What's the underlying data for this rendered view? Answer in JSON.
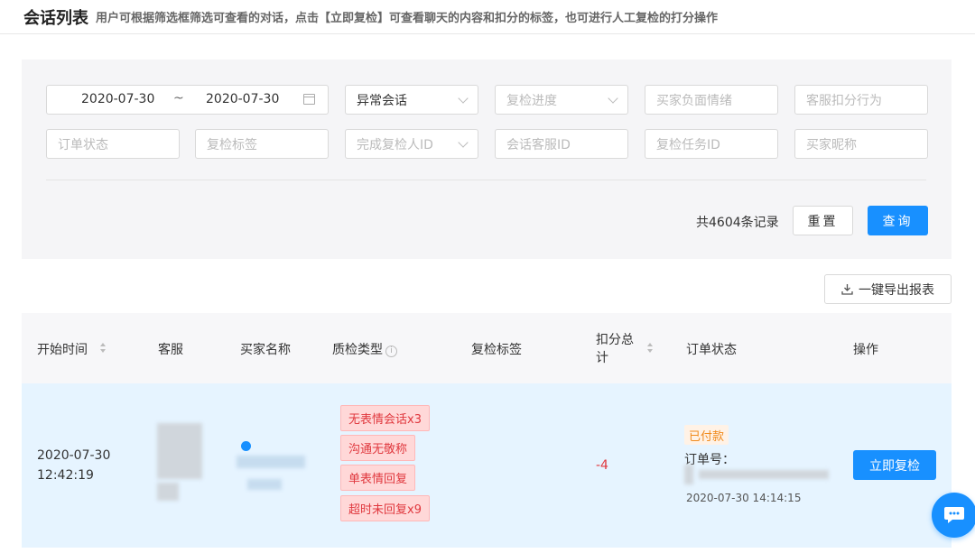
{
  "header": {
    "title": "会话列表",
    "description": "用户可根据筛选框筛选可查看的对话，点击【立即复检】可查看聊天的内容和扣分的标签，也可进行人工复检的打分操作"
  },
  "filters": {
    "date_start": "2020-07-30",
    "date_separator": "~",
    "date_end": "2020-07-30",
    "session_type_value": "异常会话",
    "review_progress_placeholder": "复检进度",
    "buyer_emotion_placeholder": "买家负面情绪",
    "agent_deduction_placeholder": "客服扣分行为",
    "order_status_placeholder": "订单状态",
    "review_tag_placeholder": "复检标签",
    "reviewer_id_placeholder": "完成复检人ID",
    "session_agent_id_placeholder": "会话客服ID",
    "review_task_id_placeholder": "复检任务ID",
    "buyer_nickname_placeholder": "买家昵称"
  },
  "summary": {
    "total_text": "共4604条记录"
  },
  "actions": {
    "reset_label": "重置",
    "query_label": "查询",
    "export_label": "一键导出报表"
  },
  "table": {
    "columns": {
      "start_time": "开始时间",
      "agent": "客服",
      "buyer_name": "买家名称",
      "qc_type": "质检类型",
      "review_tag": "复检标签",
      "deduction_total_line1": "扣分总",
      "deduction_total_line2": "计",
      "order_status": "订单状态",
      "operation": "操作"
    },
    "rows": [
      {
        "start_date": "2020-07-30",
        "start_time": "12:42:19",
        "tags": [
          "无表情会话x3",
          "沟通无敬称",
          "单表情回复",
          "超时未回复x9"
        ],
        "deduction": "-4",
        "order_status_badge": "已付款",
        "order_no_label": "订单号：",
        "order_time": "2020-07-30 14:14:15",
        "action_label": "立即复检"
      }
    ]
  },
  "colors": {
    "primary": "#1890ff",
    "tag_text": "#e0383e",
    "tag_bg": "#ffd8d8",
    "deduction": "#e0383e",
    "badge_text": "#f08a1c",
    "row_highlight": "#e6f4ff"
  },
  "icons": [
    "calendar-icon",
    "chevron-down-icon",
    "download-icon",
    "sort-icon",
    "info-icon",
    "chat-icon"
  ]
}
